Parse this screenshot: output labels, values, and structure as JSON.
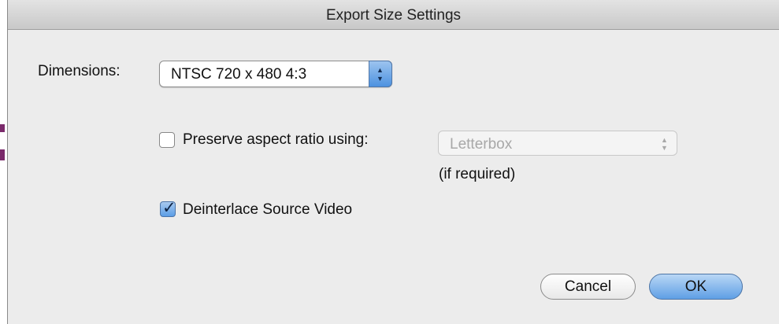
{
  "window": {
    "title": "Export Size Settings"
  },
  "dimensions": {
    "label": "Dimensions:",
    "selected": "NTSC 720 x 480 4:3"
  },
  "preserve_aspect": {
    "label": "Preserve aspect ratio using:",
    "checked": false,
    "selected": "Letterbox",
    "enabled": false,
    "note": "(if required)"
  },
  "deinterlace": {
    "label": "Deinterlace Source Video",
    "checked": true
  },
  "buttons": {
    "cancel": "Cancel",
    "ok": "OK"
  },
  "icons": {
    "popup": "stepper-arrows-icon",
    "checkbox_checked": "checkmark-icon"
  },
  "colors": {
    "accent": "#5f9fe5",
    "disabled_text": "#a8a8a8"
  }
}
